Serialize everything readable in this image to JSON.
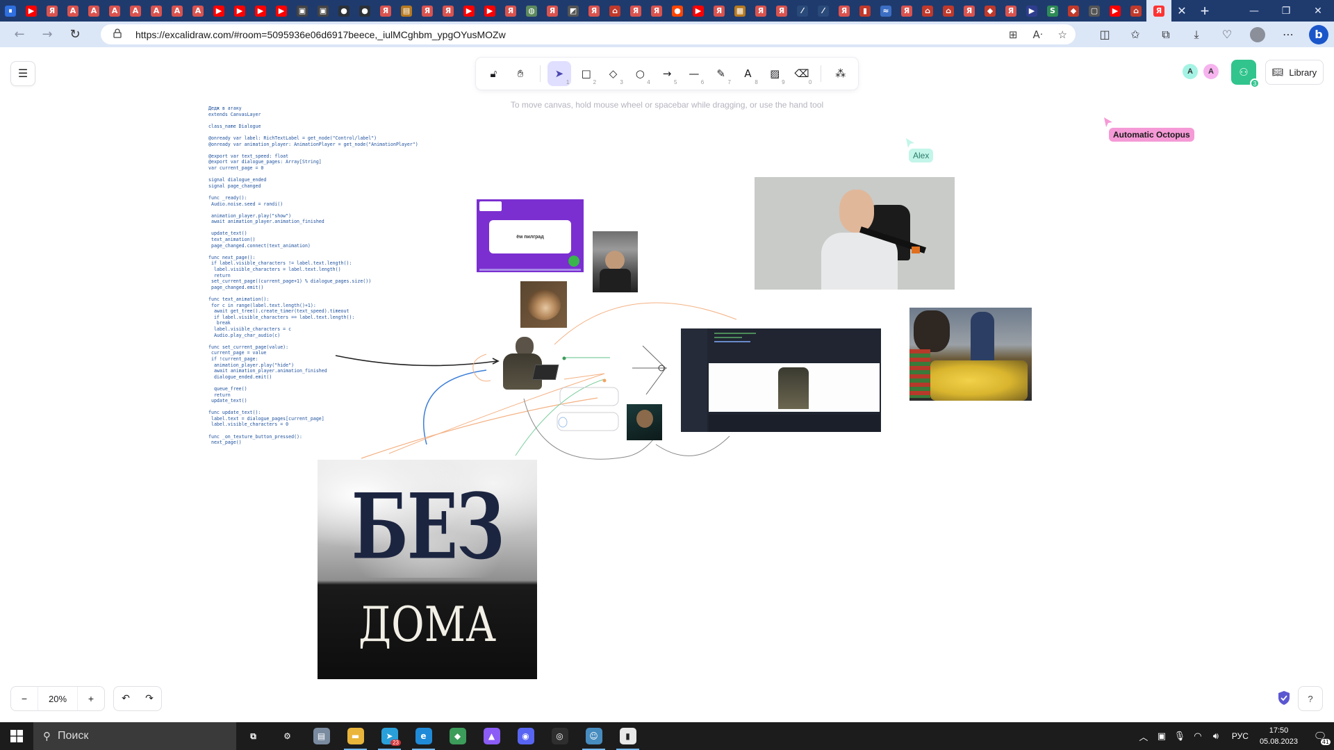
{
  "browser": {
    "tabs": [
      {
        "icon": "pause-icon",
        "color": "#2f6fde",
        "glyph": "⏸"
      },
      {
        "icon": "youtube-icon",
        "color": "#ff0000",
        "glyph": "▶"
      },
      {
        "icon": "yandex-icon",
        "color": "#d9534f",
        "glyph": "Я"
      },
      {
        "icon": "letter-a-icon",
        "color": "#d9534f",
        "glyph": "A"
      },
      {
        "icon": "letter-a-icon",
        "color": "#d9534f",
        "glyph": "A"
      },
      {
        "icon": "letter-a-icon",
        "color": "#d9534f",
        "glyph": "A"
      },
      {
        "icon": "letter-a-icon",
        "color": "#d9534f",
        "glyph": "A"
      },
      {
        "icon": "letter-a-icon",
        "color": "#d9534f",
        "glyph": "A"
      },
      {
        "icon": "letter-a-icon",
        "color": "#d9534f",
        "glyph": "A"
      },
      {
        "icon": "letter-a-icon",
        "color": "#d9534f",
        "glyph": "A"
      },
      {
        "icon": "youtube-icon",
        "color": "#ff0000",
        "glyph": "▶"
      },
      {
        "icon": "youtube-icon",
        "color": "#ff0000",
        "glyph": "▶"
      },
      {
        "icon": "youtube-icon",
        "color": "#ff0000",
        "glyph": "▶"
      },
      {
        "icon": "youtube-icon",
        "color": "#ff0000",
        "glyph": "▶"
      },
      {
        "icon": "code-icon",
        "color": "#444444",
        "glyph": "▣"
      },
      {
        "icon": "code-icon",
        "color": "#444444",
        "glyph": "▣"
      },
      {
        "icon": "github-icon",
        "color": "#2b3137",
        "glyph": "●"
      },
      {
        "icon": "github-icon",
        "color": "#2b3137",
        "glyph": "●"
      },
      {
        "icon": "yandex-icon",
        "color": "#d9534f",
        "glyph": "Я"
      },
      {
        "icon": "ozon-icon",
        "color": "#b7791f",
        "glyph": "▤"
      },
      {
        "icon": "yandex-icon",
        "color": "#d9534f",
        "glyph": "Я"
      },
      {
        "icon": "yandex-icon",
        "color": "#d9534f",
        "glyph": "Я"
      },
      {
        "icon": "youtube-icon",
        "color": "#ff0000",
        "glyph": "▶"
      },
      {
        "icon": "youtube-icon",
        "color": "#ff0000",
        "glyph": "▶"
      },
      {
        "icon": "yandex-icon",
        "color": "#d9534f",
        "glyph": "Я"
      },
      {
        "icon": "globe-icon",
        "color": "#5d8a5d",
        "glyph": "◍"
      },
      {
        "icon": "yandex-icon",
        "color": "#d9534f",
        "glyph": "Я"
      },
      {
        "icon": "excalidraw-icon",
        "color": "#555555",
        "glyph": "◩"
      },
      {
        "icon": "yandex-icon",
        "color": "#d9534f",
        "glyph": "Я"
      },
      {
        "icon": "store-icon",
        "color": "#c0392b",
        "glyph": "⌂"
      },
      {
        "icon": "yandex-icon",
        "color": "#d9534f",
        "glyph": "Я"
      },
      {
        "icon": "yandex-icon",
        "color": "#d9534f",
        "glyph": "Я"
      },
      {
        "icon": "reddit-icon",
        "color": "#ff4500",
        "glyph": "●"
      },
      {
        "icon": "youtube-icon",
        "color": "#ff0000",
        "glyph": "▶"
      },
      {
        "icon": "yandex-icon",
        "color": "#d9534f",
        "glyph": "Я"
      },
      {
        "icon": "image-icon",
        "color": "#b7791f",
        "glyph": "▦"
      },
      {
        "icon": "yandex-icon",
        "color": "#d9534f",
        "glyph": "Я"
      },
      {
        "icon": "yandex-icon",
        "color": "#d9534f",
        "glyph": "Я"
      },
      {
        "icon": "chart-icon",
        "color": "#2a4a7a",
        "glyph": "⁄"
      },
      {
        "icon": "chart-icon",
        "color": "#2a4a7a",
        "glyph": "⁄"
      },
      {
        "icon": "yandex-icon",
        "color": "#d9534f",
        "glyph": "Я"
      },
      {
        "icon": "document-icon",
        "color": "#c0392b",
        "glyph": "▮"
      },
      {
        "icon": "wave-icon",
        "color": "#3c6fc4",
        "glyph": "≈"
      },
      {
        "icon": "yandex-icon",
        "color": "#d9534f",
        "glyph": "Я"
      },
      {
        "icon": "store-icon",
        "color": "#c0392b",
        "glyph": "⌂"
      },
      {
        "icon": "store-icon",
        "color": "#c0392b",
        "glyph": "⌂"
      },
      {
        "icon": "yandex-icon",
        "color": "#d9534f",
        "glyph": "Я"
      },
      {
        "icon": "diamond-icon",
        "color": "#c0392b",
        "glyph": "◆"
      },
      {
        "icon": "yandex-icon",
        "color": "#d9534f",
        "glyph": "Я"
      },
      {
        "icon": "terminal-icon",
        "color": "#2f3d8f",
        "glyph": "▶"
      },
      {
        "icon": "s-icon",
        "color": "#2e8b57",
        "glyph": "S"
      },
      {
        "icon": "diamond-icon",
        "color": "#c0392b",
        "glyph": "◆"
      },
      {
        "icon": "page-icon",
        "color": "#555555",
        "glyph": "▢"
      },
      {
        "icon": "youtube-icon",
        "color": "#ff0000",
        "glyph": "▶"
      },
      {
        "icon": "store-icon",
        "color": "#c0392b",
        "glyph": "⌂"
      }
    ],
    "active_tab": {
      "icon": "yandex-icon",
      "color": "#ff3333",
      "glyph": "Я"
    },
    "close_glyph": "✕",
    "new_tab_glyph": "+",
    "window": {
      "minimize": "—",
      "restore": "❐",
      "close": "✕"
    },
    "url": "https://excalidraw.com/#room=5095936e06d6917beece,_iulMCghbm_ypgOYusMOZw",
    "nav": {
      "back": "←",
      "forward": "→",
      "reload": "↻"
    }
  },
  "excalidraw": {
    "menu_glyph": "☰",
    "tools": [
      {
        "name": "lock-tool",
        "glyph": "🔓︎",
        "key": ""
      },
      {
        "name": "hand-tool",
        "glyph": "✋︎",
        "key": ""
      },
      {
        "name": "selection-tool",
        "glyph": "➤",
        "key": "1"
      },
      {
        "name": "rectangle-tool",
        "glyph": "□",
        "key": "2"
      },
      {
        "name": "diamond-tool",
        "glyph": "◇",
        "key": "3"
      },
      {
        "name": "ellipse-tool",
        "glyph": "○",
        "key": "4"
      },
      {
        "name": "arrow-tool",
        "glyph": "→",
        "key": "5"
      },
      {
        "name": "line-tool",
        "glyph": "—",
        "key": "6"
      },
      {
        "name": "draw-tool",
        "glyph": "✎",
        "key": "7"
      },
      {
        "name": "text-tool",
        "glyph": "A",
        "key": "8"
      },
      {
        "name": "image-tool",
        "glyph": "▨",
        "key": "9"
      },
      {
        "name": "eraser-tool",
        "glyph": "⌫",
        "key": "0"
      },
      {
        "name": "extra-tools",
        "glyph": "⁂",
        "key": ""
      }
    ],
    "hint": "To move canvas, hold mouse wheel or spacebar while dragging, or use the hand tool",
    "collaborators": [
      {
        "initial": "A",
        "color": "#a5f3e4"
      },
      {
        "initial": "A",
        "color": "#f6b3ee"
      }
    ],
    "share_count": "3",
    "library_label": "Library",
    "cursors": [
      {
        "label": "Automatic Octopus",
        "color": "#f59ad6"
      },
      {
        "label": "Alex",
        "color": "#c3f5e9"
      }
    ],
    "zoom": {
      "out": "−",
      "value": "20%",
      "in": "+"
    },
    "undo": "↶",
    "redo": "↷",
    "help": "?",
    "poster": {
      "top": "БЕЗ",
      "bottom": "ДОМА"
    },
    "dialog_text": "ём пилград"
  },
  "code_lines": [
    "Дедж в атаку",
    "extends CanvasLayer",
    "",
    "class_name Dialogue",
    "",
    "@onready var label: RichTextLabel = get_node(\"Control/label\")",
    "@onready var animation_player: AnimationPlayer = get_node(\"AnimationPlayer\")",
    "",
    "@export var text_speed: float",
    "@export var dialogue_pages: Array[String]",
    "var current_page = 0",
    "",
    "signal dialogue_ended",
    "signal page_changed",
    "",
    "func _ready():",
    " Audio.noise.seed = randi()",
    "",
    " animation_player.play(\"show\")",
    " await animation_player.animation_finished",
    "",
    " update_text()",
    " text_animation()",
    " page_changed.connect(text_animation)",
    "",
    "func next_page():",
    " if label.visible_characters != label.text.length():",
    "  label.visible_characters = label.text.length()",
    "  return",
    " set_current_page((current_page+1) % dialogue_pages.size())",
    " page_changed.emit()",
    "",
    "func text_animation():",
    " for c in range(label.text.length()+1):",
    "  await get_tree().create_timer(text_speed).timeout",
    "  if label.visible_characters == label.text.length():",
    "   break",
    "  label.visible_characters = c",
    "  Audio.play_char_audio(c)",
    "",
    "func set_current_page(value):",
    " current_page = value",
    " if !current_page:",
    "  animation_player.play(\"hide\")",
    "  await animation_player.animation_finished",
    "  dialogue_ended.emit()",
    "",
    "  queue_free()",
    "  return",
    " update_text()",
    "",
    "func update_text():",
    " label.text = dialogue_pages[current_page]",
    " label.visible_characters = 0",
    "",
    "func _on_texture_button_pressed():",
    " next_page()"
  ],
  "taskbar": {
    "search_placeholder": "Поиск",
    "apps": [
      {
        "name": "task-view",
        "color": "#1c1c1c",
        "glyph": "⧉",
        "open": false,
        "badge": ""
      },
      {
        "name": "settings",
        "color": "#1c1c1c",
        "glyph": "⚙",
        "open": false,
        "badge": ""
      },
      {
        "name": "app-store",
        "color": "#7a8ba0",
        "glyph": "▤",
        "open": false,
        "badge": ""
      },
      {
        "name": "file-explorer",
        "color": "#e9b53a",
        "glyph": "▬",
        "open": true,
        "badge": ""
      },
      {
        "name": "telegram",
        "color": "#2aa0da",
        "glyph": "➤",
        "open": true,
        "badge": "23"
      },
      {
        "name": "edge",
        "color": "#1f8ad8",
        "glyph": "e",
        "open": true,
        "badge": ""
      },
      {
        "name": "git-kraken",
        "color": "#3c9c5a",
        "glyph": "◆",
        "open": false,
        "badge": ""
      },
      {
        "name": "purple-app",
        "color": "#8b5cf6",
        "glyph": "▲",
        "open": false,
        "badge": ""
      },
      {
        "name": "discord",
        "color": "#5865f2",
        "glyph": "◉",
        "open": false,
        "badge": ""
      },
      {
        "name": "obs",
        "color": "#2e2e2e",
        "glyph": "◎",
        "open": false,
        "badge": ""
      },
      {
        "name": "godot",
        "color": "#478cbf",
        "glyph": "☺",
        "open": true,
        "badge": ""
      },
      {
        "name": "twitch",
        "color": "#e9e9e9",
        "glyph": "▮",
        "open": true,
        "badge": ""
      }
    ],
    "tray_up": "︿",
    "lang": "РУС",
    "time": "17:50",
    "date": "05.08.2023",
    "notifications": "41"
  }
}
